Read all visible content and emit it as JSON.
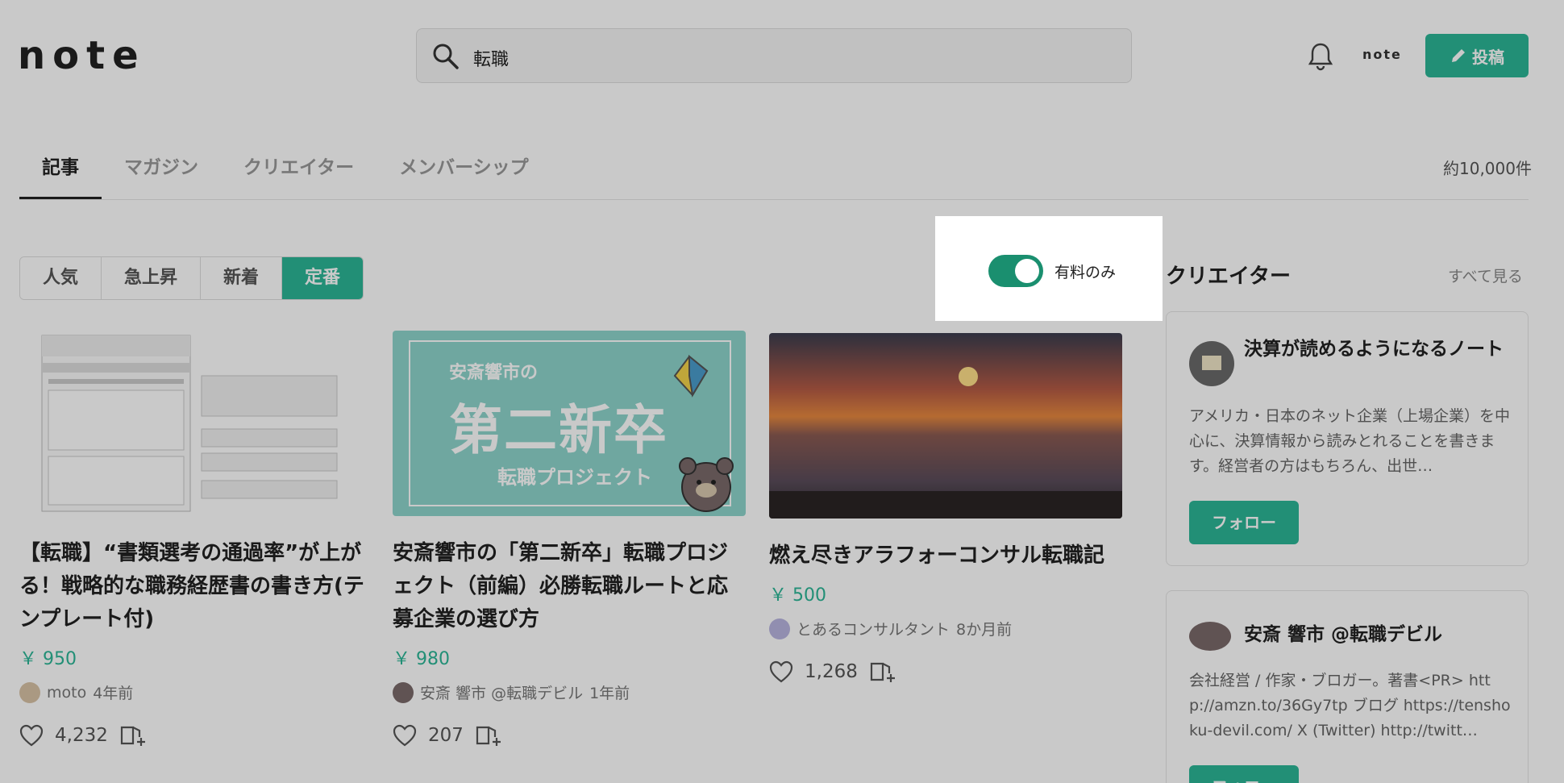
{
  "header": {
    "logo": "note",
    "search_value": "転職",
    "small_logo": "note",
    "post_label": "投稿"
  },
  "tabs": [
    "記事",
    "マガジン",
    "クリエイター",
    "メンバーシップ"
  ],
  "result_count": "約10,000件",
  "sort": [
    "人気",
    "急上昇",
    "新着",
    "定番"
  ],
  "filter": {
    "label": "有料のみ",
    "on": true
  },
  "articles": [
    {
      "title": "【転職】“書類選考の通過率”が上がる！戦略的な職務経歴書の書き方(テンプレート付)",
      "price": "￥ 950",
      "author": "moto",
      "time": "4年前",
      "likes": "4,232"
    },
    {
      "title": "安斎響市の「第二新卒」転職プロジェクト（前編）必勝転職ルートと応募企業の選び方",
      "price": "￥ 980",
      "author": "安斎 響市 @転職デビル",
      "time": "1年前",
      "likes": "207",
      "thumb": {
        "top": "安斎響市の",
        "main": "第二新卒",
        "sub": "転職プロジェクト"
      }
    },
    {
      "title": "燃え尽きアラフォーコンサル転職記",
      "price": "￥ 500",
      "author": "とあるコンサルタント",
      "time": "8か月前",
      "likes": "1,268"
    }
  ],
  "sidebar": {
    "title": "クリエイター",
    "see_all": "すべて見る",
    "creators": [
      {
        "name": "決算が読めるようになるノート",
        "desc": "アメリカ・日本のネット企業（上場企業）を中心に、決算情報から読みとれることを書きます。経営者の方はもちろん、出世…",
        "follow": "フォロー"
      },
      {
        "name": "安斎 響市 @転職デビル",
        "desc": "会社経営 / 作家・ブロガー。著書<PR> http://amzn.to/36Gy7tp ブログ https://tenshoku-devil.com/ X (Twitter) http://twitt…",
        "follow": "フォロー"
      }
    ]
  },
  "colors": {
    "accent": "#2cb696",
    "toggle": "#1a8f6f"
  }
}
